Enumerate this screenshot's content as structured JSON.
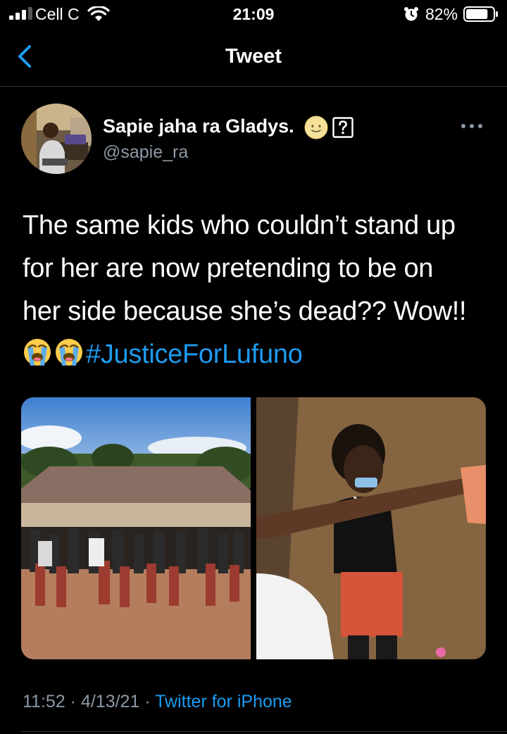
{
  "status_bar": {
    "carrier": "Cell C",
    "time": "21:09",
    "battery_percent": "82%",
    "battery_level": 0.82,
    "signal_bars": 3,
    "signal_max": 4,
    "icons": [
      "signal-icon",
      "wifi-icon",
      "alarm-icon",
      "battery-icon"
    ]
  },
  "nav": {
    "title": "Tweet",
    "back_icon": "chevron-left-icon"
  },
  "author": {
    "name": "Sapie jaha ra Gladys.",
    "handle": "@sapie_ra",
    "name_icons": [
      "smiling-face-emoji",
      "unknown-glyph-box"
    ]
  },
  "tweet": {
    "lines": [
      "The same kids who couldn’t stand up",
      "for her are now pretending to be on",
      "her side because she’s dead?? Wow!!"
    ],
    "emojis": [
      "loudly-crying-face-emoji",
      "loudly-crying-face-emoji"
    ],
    "hashtag": "#JusticeForLufuno"
  },
  "media": [
    {
      "kind": "photo",
      "subject": "students-in-school-uniform-outside-building"
    },
    {
      "kind": "photo",
      "subject": "girl-in-school-uniform-with-mask"
    }
  ],
  "meta": {
    "time": "11:52",
    "separator": "·",
    "date": "4/13/21",
    "source": "Twitter for iPhone"
  },
  "colors": {
    "background": "#000000",
    "text": "#ffffff",
    "secondary": "#8b98a5",
    "link": "#1d9bf0",
    "divider": "#2f3336"
  }
}
